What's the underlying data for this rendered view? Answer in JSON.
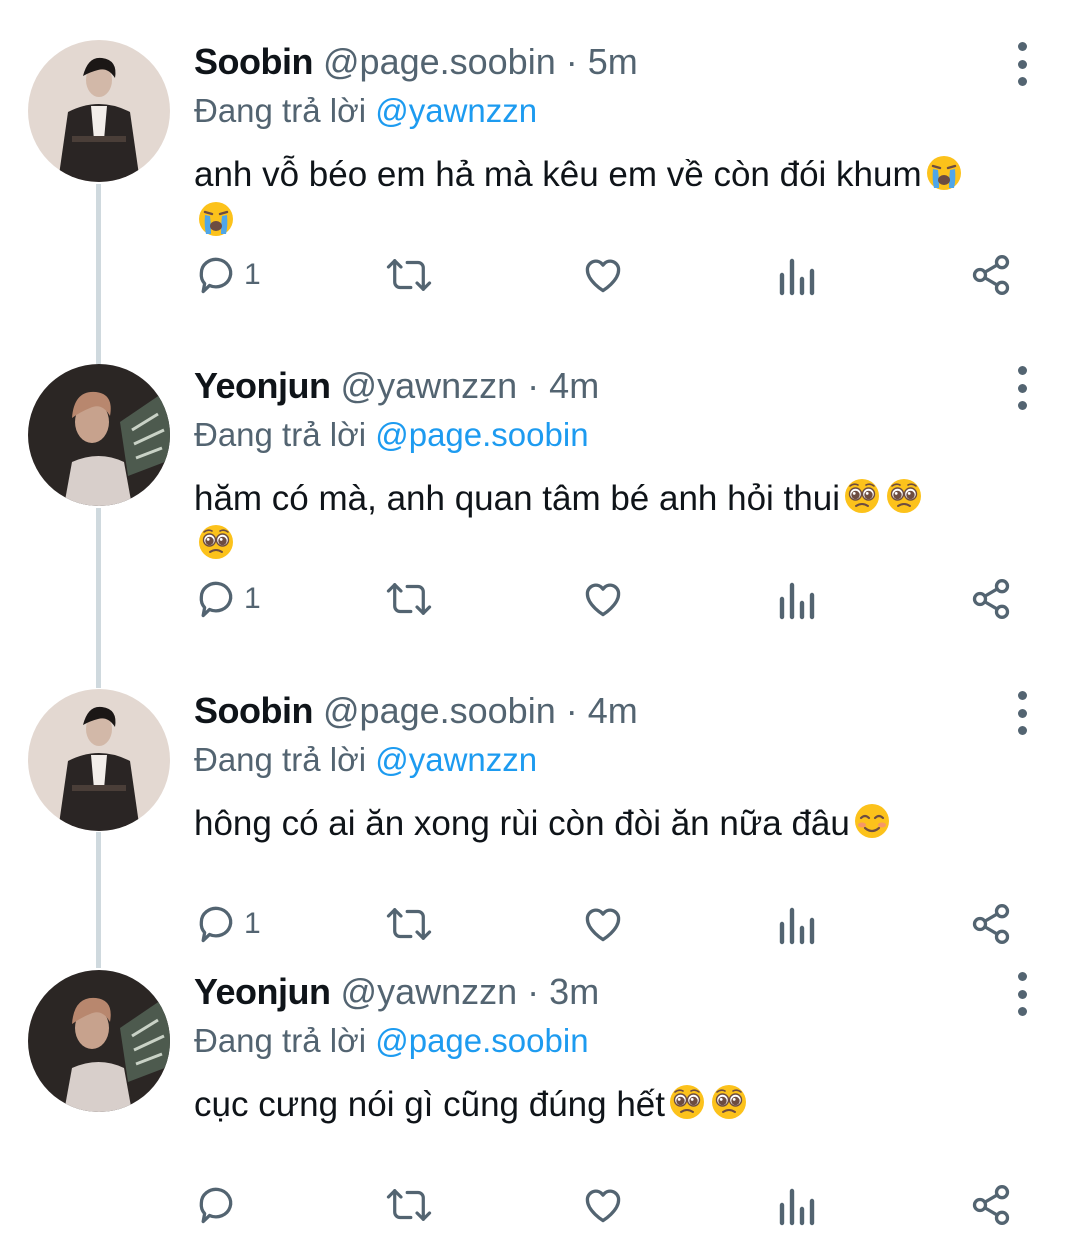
{
  "thread": {
    "reply_prefix": "Đang trả lời",
    "tweets": [
      {
        "name": "Soobin",
        "handle": "@page.soobin",
        "time": "5m",
        "reply_to": "@yawnzzn",
        "text": "anh vỗ béo em hả mà kêu em về còn đói khum",
        "emojis": [
          "loudly-crying-face",
          "loudly-crying-face"
        ],
        "reply_count": "1",
        "avatar": "soobin-avatar"
      },
      {
        "name": "Yeonjun",
        "handle": "@yawnzzn",
        "time": "4m",
        "reply_to": "@page.soobin",
        "text": "hăm có mà, anh quan tâm bé anh hỏi thui",
        "emojis": [
          "pleading-face",
          "pleading-face",
          "pleading-face"
        ],
        "reply_count": "1",
        "avatar": "yeonjun-avatar"
      },
      {
        "name": "Soobin",
        "handle": "@page.soobin",
        "time": "4m",
        "reply_to": "@yawnzzn",
        "text": "hông có ai ăn xong rùi còn đòi ăn nữa đâu",
        "emojis": [
          "smiling-face"
        ],
        "reply_count": "1",
        "avatar": "soobin-avatar"
      },
      {
        "name": "Yeonjun",
        "handle": "@yawnzzn",
        "time": "3m",
        "reply_to": "@page.soobin",
        "text": "cục cưng nói gì cũng đúng hết",
        "emojis": [
          "pleading-face",
          "pleading-face"
        ],
        "reply_count": "",
        "avatar": "yeonjun-avatar"
      }
    ]
  },
  "colors": {
    "text": "#0f1419",
    "secondary": "#536471",
    "accent": "#1d9bf0",
    "thread_line": "#cfd9de",
    "emoji_yellow": "#fcc21b"
  }
}
